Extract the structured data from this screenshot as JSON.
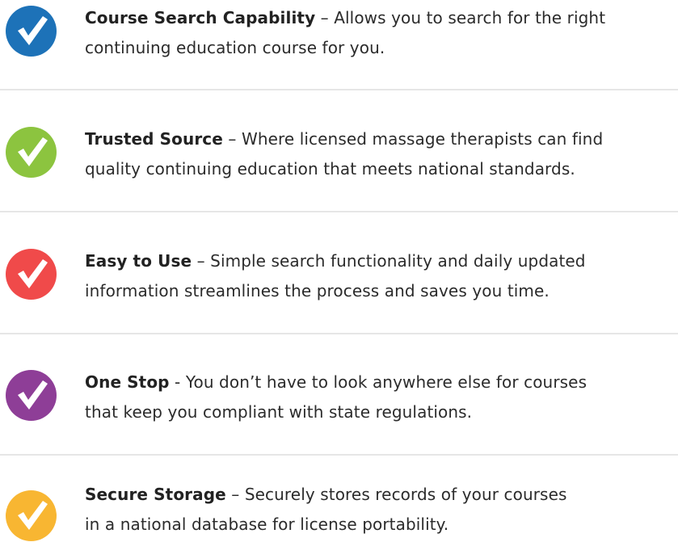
{
  "colors": {
    "blue": "#1d72b8",
    "green": "#8cc43f",
    "red": "#f04a4a",
    "purple": "#8e3e97",
    "yellow": "#f8b632",
    "check": "#ffffff",
    "divider": "#e6e6e6"
  },
  "features": [
    {
      "icon": "check-circle-icon",
      "color": "#1d72b8",
      "title": "Course Search Capability",
      "separator": " – ",
      "line1_rest": "Allows you to search for the right",
      "line2": "continuing education course for you."
    },
    {
      "icon": "check-circle-icon",
      "color": "#8cc43f",
      "title": "Trusted Source",
      "separator": " – ",
      "line1_rest": "Where licensed massage therapists can find",
      "line2": "quality continuing education that meets national standards."
    },
    {
      "icon": "check-circle-icon",
      "color": "#f04a4a",
      "title": "Easy to Use",
      "separator": " – ",
      "line1_rest": "Simple search functionality and daily updated",
      "line2": "information streamlines the process and saves you time."
    },
    {
      "icon": "check-circle-icon",
      "color": "#8e3e97",
      "title": "One Stop",
      "separator": " - ",
      "line1_rest": "You don’t have to look anywhere else for courses",
      "line2": "that keep you compliant with state regulations."
    },
    {
      "icon": "check-circle-icon",
      "color": "#f8b632",
      "title": "Secure Storage",
      "separator": " – ",
      "line1_rest": "Securely stores records of your courses",
      "line2": "in a national database for license portability."
    }
  ]
}
